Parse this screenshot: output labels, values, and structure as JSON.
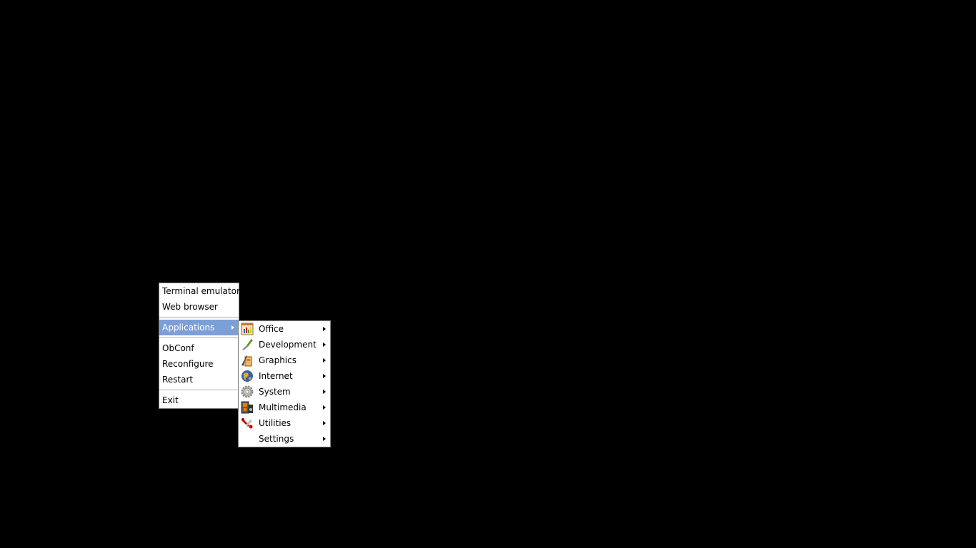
{
  "root_menu": {
    "items": [
      {
        "label": "Terminal emulator"
      },
      {
        "label": "Web browser"
      },
      {
        "label": "Applications",
        "selected": true,
        "has_submenu": true
      },
      {
        "label": "ObConf"
      },
      {
        "label": "Reconfigure"
      },
      {
        "label": "Restart"
      },
      {
        "label": "Exit"
      }
    ],
    "highlight_color": "#7d9fd8"
  },
  "applications_menu": {
    "items": [
      {
        "label": "Office",
        "icon": "office-icon"
      },
      {
        "label": "Development",
        "icon": "development-icon"
      },
      {
        "label": "Graphics",
        "icon": "graphics-icon"
      },
      {
        "label": "Internet",
        "icon": "internet-icon"
      },
      {
        "label": "System",
        "icon": "system-icon"
      },
      {
        "label": "Multimedia",
        "icon": "multimedia-icon"
      },
      {
        "label": "Utilities",
        "icon": "utilities-icon"
      },
      {
        "label": "Settings",
        "icon": ""
      }
    ]
  },
  "desktop": {
    "background": "#000000"
  }
}
